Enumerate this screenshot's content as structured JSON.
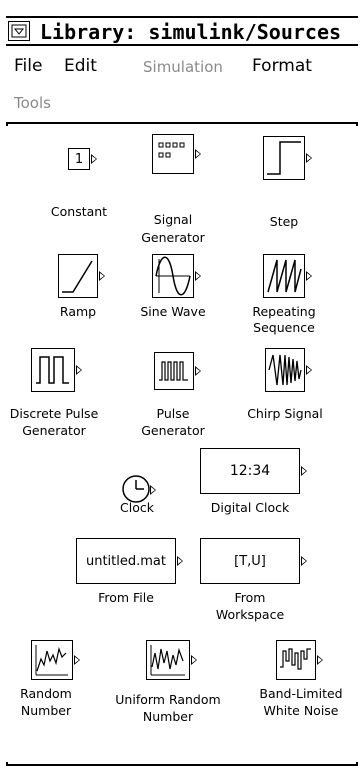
{
  "window": {
    "title": "Library: simulink/Sources",
    "menu_icon": "window-menu-icon"
  },
  "menu": {
    "file": "File",
    "edit": "Edit",
    "simulation": "Simulation",
    "format": "Format",
    "tools": "Tools"
  },
  "blocks": {
    "constant": {
      "label": "Constant",
      "value": "1"
    },
    "signal_generator": {
      "label_line1": "Signal",
      "label_line2": "Generator"
    },
    "step": {
      "label": "Step"
    },
    "ramp": {
      "label": "Ramp"
    },
    "sine_wave": {
      "label": "Sine Wave"
    },
    "repeating_sequence": {
      "label_line1": "Repeating",
      "label_line2": "Sequence"
    },
    "discrete_pulse_generator": {
      "label_line1": "Discrete Pulse",
      "label_line2": "Generator"
    },
    "pulse_generator": {
      "label_line1": "Pulse",
      "label_line2": "Generator"
    },
    "chirp_signal": {
      "label": "Chirp Signal"
    },
    "clock": {
      "label": "Clock"
    },
    "digital_clock": {
      "label": "Digital Clock",
      "display": "12:34"
    },
    "from_file": {
      "label": "From File",
      "display": "untitled.mat"
    },
    "from_workspace": {
      "label_line1": "From",
      "label_line2": "Workspace",
      "display": "[T,U]"
    },
    "random_number": {
      "label_line1": "Random",
      "label_line2": "Number"
    },
    "uniform_random_number": {
      "label_line1": "Uniform Random",
      "label_line2": "Number"
    },
    "band_limited_white_noise": {
      "label_line1": "Band-Limited",
      "label_line2": "White Noise"
    }
  }
}
